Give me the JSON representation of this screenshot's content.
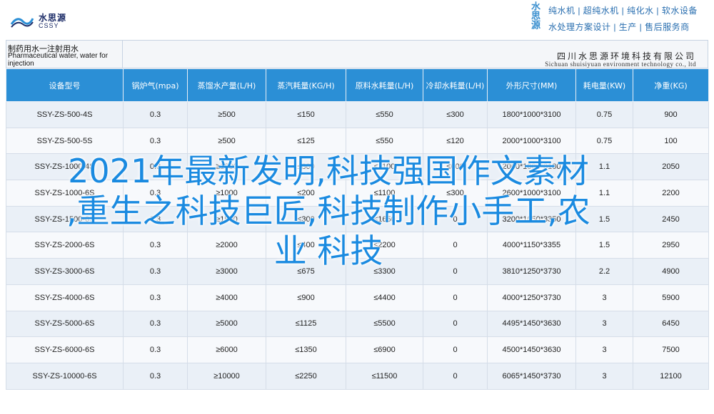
{
  "header": {
    "logo_cn": "水思源",
    "logo_en": "CSSY",
    "brand_vertical": "水思源",
    "slogan_line1": "纯水机 | 超纯水机 | 纯化水 | 软水设备",
    "slogan_line2": "水处理方案设计 | 生产 | 售后服务商"
  },
  "title": {
    "cn": "制药用水一注射用水",
    "en": "Pharmaceutical water, water for injection"
  },
  "company": {
    "cn": "四川水思源环境科技有限公司",
    "en": "Sichuan shuisiyuan environment technology co., ltd"
  },
  "table": {
    "headers": [
      "设备型号",
      "锅炉气(mpa)",
      "蒸馏水产量(L/H)",
      "蒸汽耗量(KG/H)",
      "原料水耗量(L/H)",
      "冷却水耗量(L/H)",
      "外形尺寸(MM)",
      "耗电量(KW)",
      "净重(KG)"
    ],
    "rows": [
      [
        "SSY-ZS-500-4S",
        "0.3",
        "≥500",
        "≤150",
        "≤550",
        "≤300",
        "1800*1000*3100",
        "0.75",
        "900"
      ],
      [
        "SSY-ZS-500-5S",
        "0.3",
        "≥500",
        "≤125",
        "≤550",
        "≤120",
        "2000*1000*3100",
        "0.75",
        "100"
      ],
      [
        "SSY-ZS-1000-4S",
        "0.3",
        "≥1000",
        "≤300",
        "≤1100",
        "≤600",
        "2000*1000*3100",
        "1.1",
        "2050"
      ],
      [
        "SSY-ZS-1000-6S",
        "0.3",
        "≥1000",
        "≤200",
        "≤1100",
        "≤300",
        "2600*1000*3100",
        "1.1",
        "2200"
      ],
      [
        "SSY-ZS-1500-6S",
        "0.3",
        "≥1500",
        "≤300",
        "≤1650",
        "0",
        "3200*1050*3350",
        "1.5",
        "2450"
      ],
      [
        "SSY-ZS-2000-6S",
        "0.3",
        "≥2000",
        "≤400",
        "≤2200",
        "0",
        "4000*1150*3355",
        "1.5",
        "2950"
      ],
      [
        "SSY-ZS-3000-6S",
        "0.3",
        "≥3000",
        "≤675",
        "≤3300",
        "0",
        "3810*1250*3730",
        "2.2",
        "4900"
      ],
      [
        "SSY-ZS-4000-6S",
        "0.3",
        "≥4000",
        "≤900",
        "≤4400",
        "0",
        "4000*1250*3730",
        "3",
        "5900"
      ],
      [
        "SSY-ZS-5000-6S",
        "0.3",
        "≥5000",
        "≤1125",
        "≤5500",
        "0",
        "4495*1450*3630",
        "3",
        "6450"
      ],
      [
        "SSY-ZS-6000-6S",
        "0.3",
        "≥6000",
        "≤1350",
        "≤6900",
        "0",
        "4500*1450*3630",
        "3",
        "7500"
      ],
      [
        "SSY-ZS-10000-6S",
        "0.3",
        "≥10000",
        "≤2250",
        "≤11500",
        "0",
        "6065*1450*3730",
        "3",
        "12100"
      ]
    ]
  },
  "overlay": {
    "line1": "2021年最新发明,科技强国作文素材",
    "line2": ",重生之科技巨匠,科技制作小手工,农",
    "line3": "业 科技"
  },
  "colors": {
    "header_bg": "#2b8fd6",
    "overlay_text": "#1a8ae0",
    "row_odd": "#eaf0f7",
    "row_even": "#f7f9fc"
  }
}
